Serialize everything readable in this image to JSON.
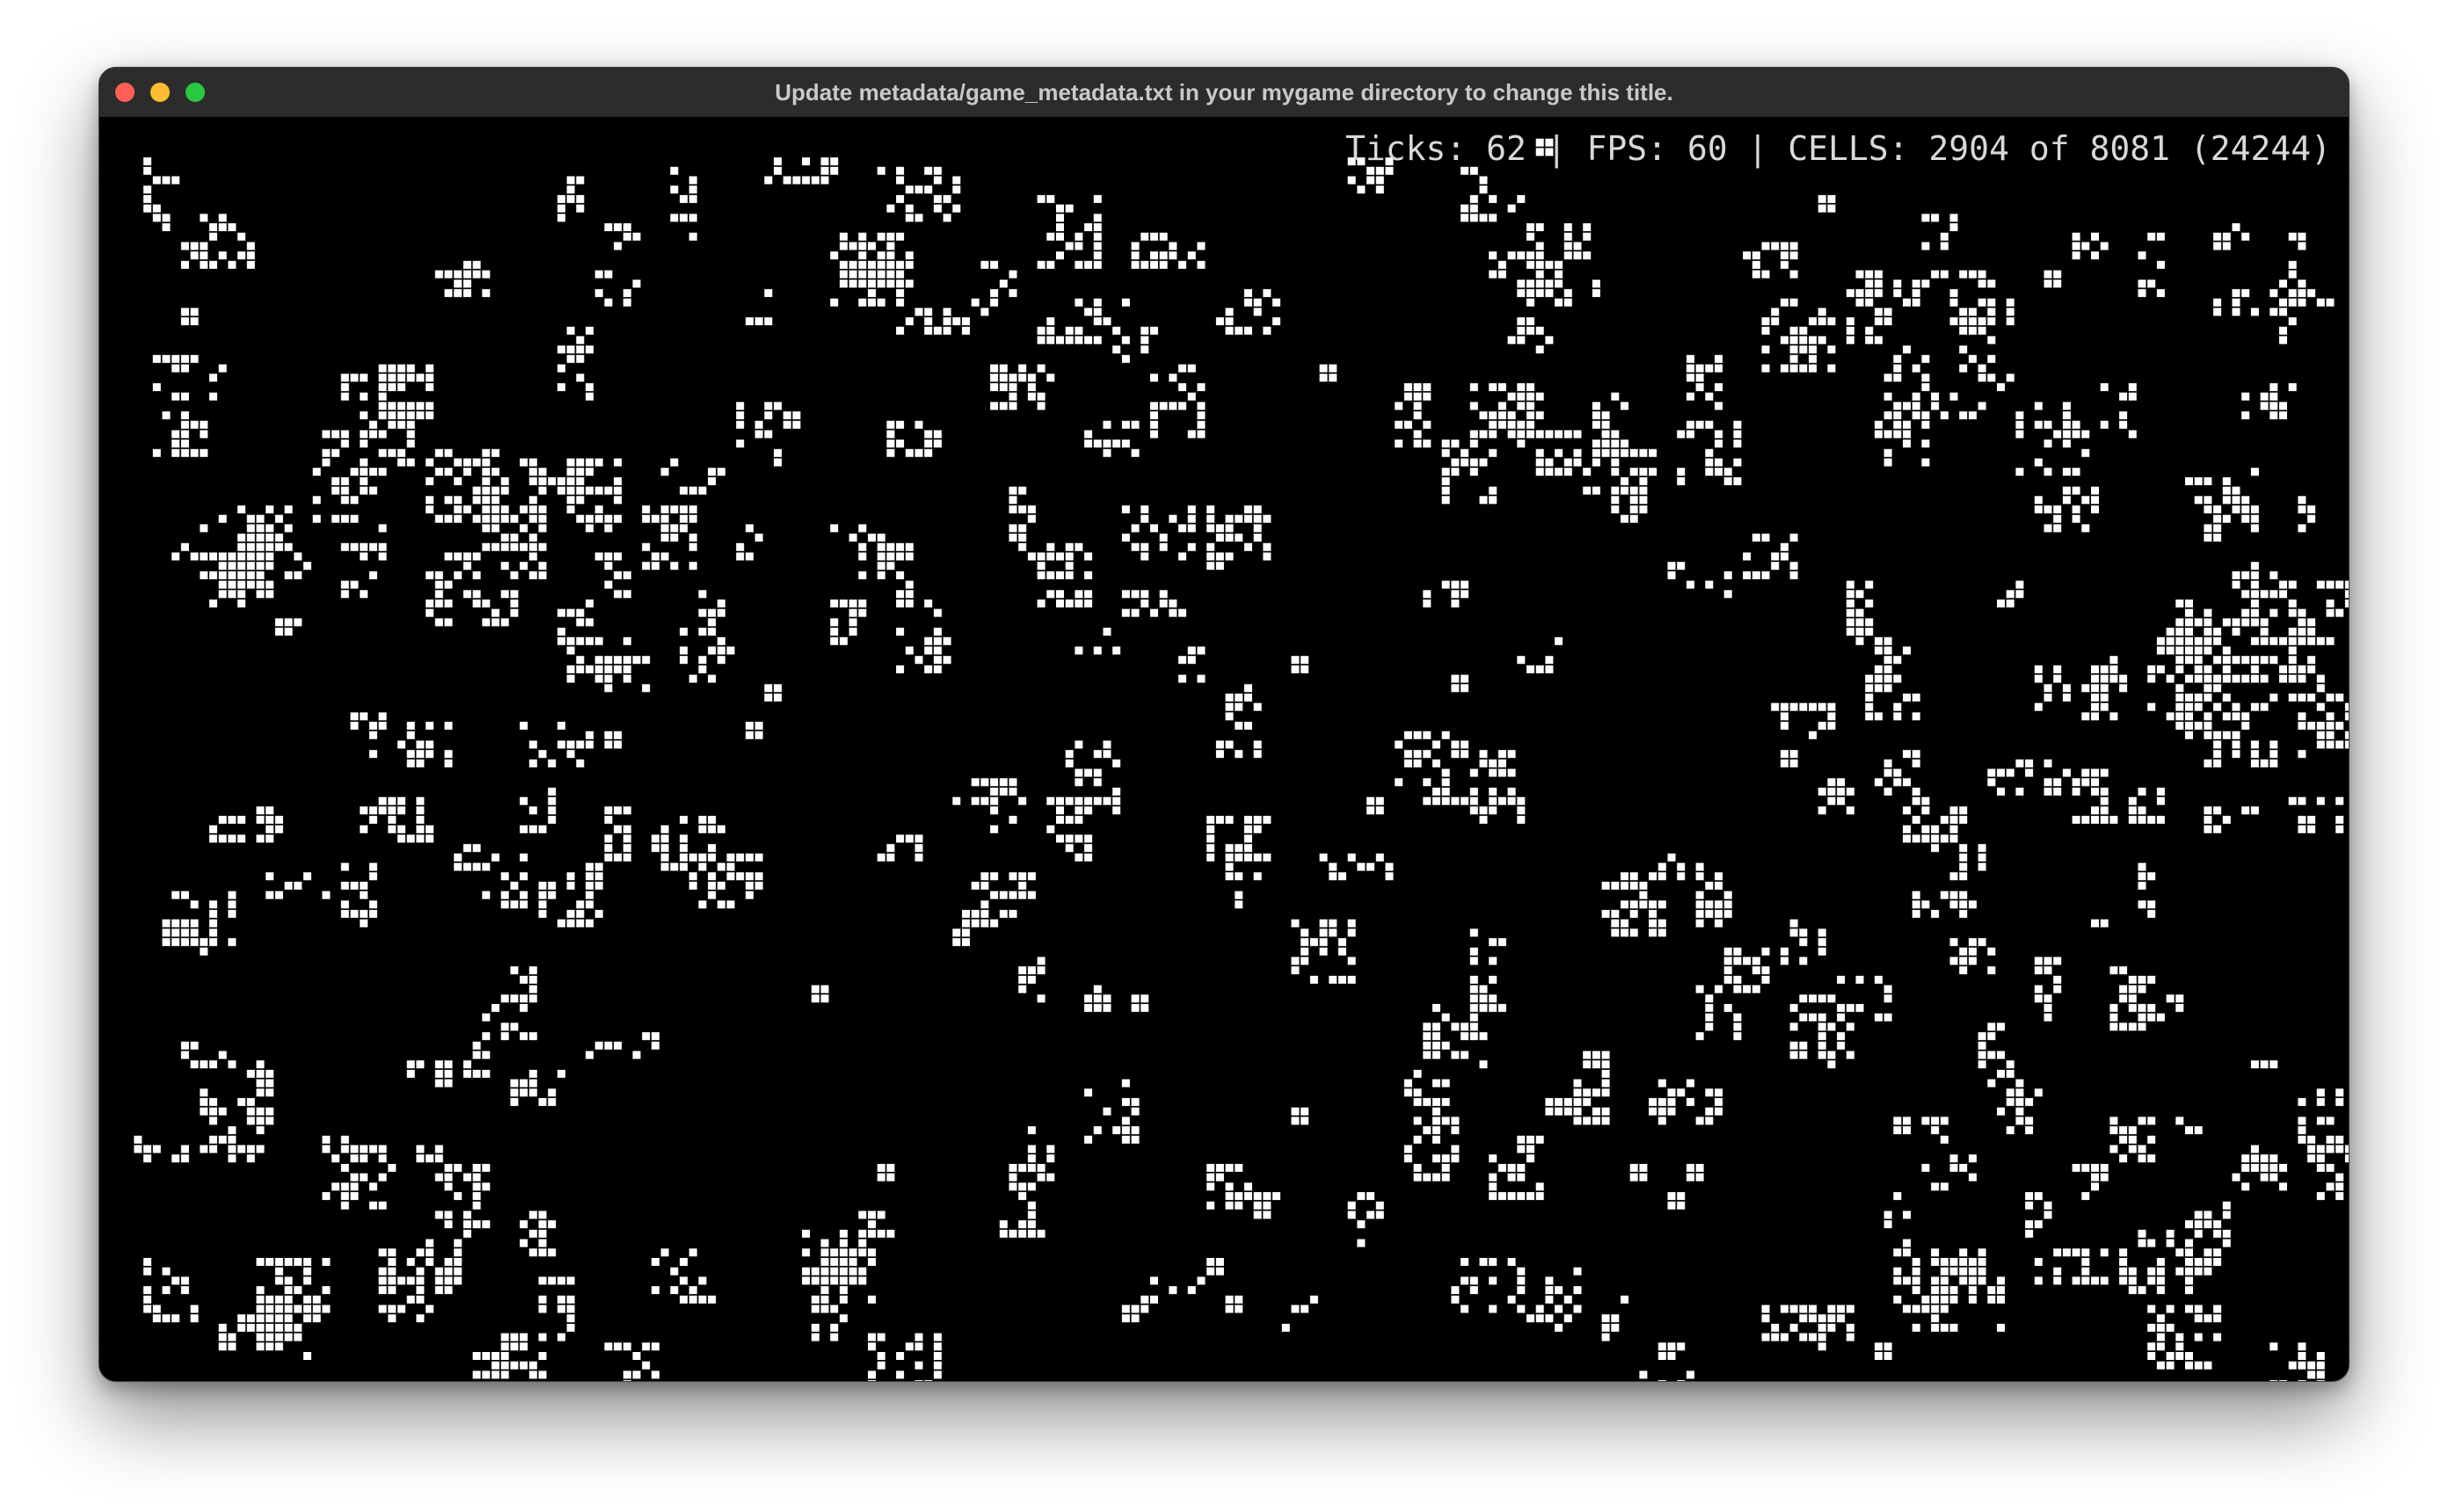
{
  "window": {
    "title": "Update metadata/game_metadata.txt in your mygame directory to change this title."
  },
  "hud": {
    "text": "Ticks: 62 | FPS: 60 | CELLS: 2904 of 8081 (24244)"
  },
  "game": {
    "cell_color": "#ffffff",
    "background_color": "#000000"
  }
}
